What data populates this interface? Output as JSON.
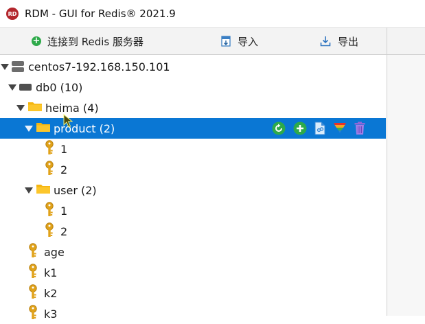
{
  "window": {
    "title": "RDM - GUI for Redis® 2021.9",
    "logo_text": "RD"
  },
  "toolbar": {
    "connect_label": "连接到 Redis 服务器",
    "import_label": "导入",
    "export_label": "导出"
  },
  "tree": {
    "server": {
      "label": "centos7-192.168.150.101"
    },
    "db": {
      "label": "db0  (10)"
    },
    "folder_heima": {
      "label": "heima (4)"
    },
    "folder_product": {
      "label": "product (2)"
    },
    "product_keys": [
      "1",
      "2"
    ],
    "folder_user": {
      "label": "user (2)"
    },
    "user_keys": [
      "1",
      "2"
    ],
    "root_keys": [
      "age",
      "k1",
      "k2",
      "k3"
    ]
  },
  "colors": {
    "selection": "#0a77d4",
    "folder": "#f5b50f",
    "key": "#e0a21a",
    "reload": "#2eaa4a",
    "delete": "#8e67d8"
  },
  "icons": {
    "row_actions": [
      "reload-icon",
      "add-key-icon",
      "open-icon",
      "filter-icon",
      "delete-icon"
    ]
  }
}
